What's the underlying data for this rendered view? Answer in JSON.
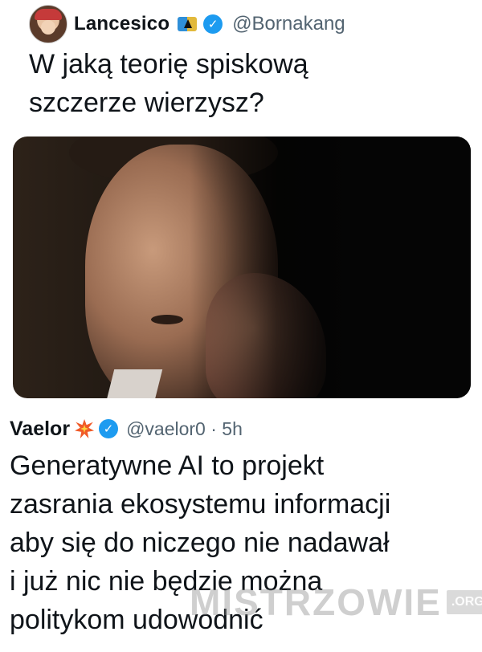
{
  "original_tweet": {
    "display_name": "Lancesico",
    "handle": "@Bornakang",
    "text": "W jaką teorię spiskową\nszczerze wierzysz?"
  },
  "reply": {
    "display_name": "Vaelor",
    "handle_time": "@vaelor0 · 5h",
    "text": "Generatywne AI to projekt\nzasrania ekosystemu informacji\naby się do niczego nie nadawał\ni już nic nie będzie można\npolitykom udowodnić"
  },
  "watermark": {
    "text": "MISTRZOWIE",
    "suffix": ".ORG"
  },
  "icons": {
    "verified": "verified-badge-icon",
    "flag": "flag-badge-icon",
    "burst": "collision-emoji-icon"
  },
  "colors": {
    "verified_blue": "#1d9bf0",
    "handle_gray": "#536471",
    "text": "#0f1419"
  }
}
